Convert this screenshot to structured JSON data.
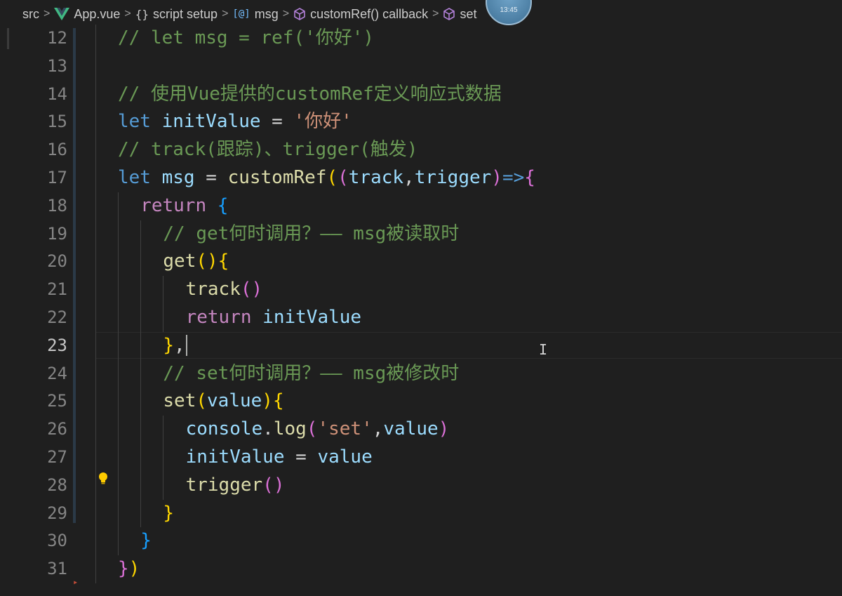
{
  "breadcrumb": {
    "items": [
      {
        "label": "src",
        "icon": ""
      },
      {
        "label": "App.vue",
        "icon": "vue-icon"
      },
      {
        "label": "script setup",
        "icon": "braces-icon"
      },
      {
        "label": "msg",
        "icon": "variable-icon"
      },
      {
        "label": "customRef() callback",
        "icon": "cube-icon"
      },
      {
        "label": "set",
        "icon": "cube-icon"
      }
    ],
    "separator": ">"
  },
  "avatar": {
    "text": "13:45"
  },
  "editor": {
    "current_line": "23",
    "colors": {
      "background": "#1f1f1f",
      "comment": "#6a9955",
      "keyword": "#569cd6",
      "control": "#c586c0",
      "variable": "#9cdcfe",
      "function": "#dcdcaa",
      "string": "#ce9178",
      "bracket_level1": "#ffd700",
      "bracket_level2": "#da70d6",
      "bracket_level3": "#179fff"
    },
    "lines": [
      {
        "n": "12",
        "t": [
          "// let msg = ref('你好')"
        ]
      },
      {
        "n": "13",
        "t": []
      },
      {
        "n": "14",
        "t": [
          "// 使用Vue提供的customRef定义响应式数据"
        ]
      },
      {
        "n": "15",
        "t": [
          "let",
          " ",
          "initValue",
          " = ",
          "'你好'"
        ]
      },
      {
        "n": "16",
        "t": [
          "// track(跟踪)、trigger(触发)"
        ]
      },
      {
        "n": "17",
        "t": [
          "let",
          " ",
          "msg",
          " = ",
          "customRef",
          "(",
          "(",
          "track",
          ",",
          "trigger",
          ")",
          "=>",
          "{"
        ]
      },
      {
        "n": "18",
        "t": [
          "return",
          " ",
          "{"
        ]
      },
      {
        "n": "19",
        "t": [
          "// get何时调用？—— msg被读取时"
        ]
      },
      {
        "n": "20",
        "t": [
          "get",
          "(",
          ")",
          "{"
        ]
      },
      {
        "n": "21",
        "t": [
          "track",
          "(",
          ")"
        ]
      },
      {
        "n": "22",
        "t": [
          "return",
          " ",
          "initValue"
        ]
      },
      {
        "n": "23",
        "t": [
          "}",
          ","
        ]
      },
      {
        "n": "24",
        "t": [
          "// set何时调用？—— msg被修改时"
        ]
      },
      {
        "n": "25",
        "t": [
          "set",
          "(",
          "value",
          ")",
          "{"
        ]
      },
      {
        "n": "26",
        "t": [
          "console",
          ".",
          "log",
          "(",
          "'set'",
          ",",
          "value",
          ")"
        ]
      },
      {
        "n": "27",
        "t": [
          "initValue",
          " = ",
          "value"
        ]
      },
      {
        "n": "28",
        "t": [
          "trigger",
          "(",
          ")"
        ]
      },
      {
        "n": "29",
        "t": [
          "}"
        ]
      },
      {
        "n": "30",
        "t": [
          "}"
        ]
      },
      {
        "n": "31",
        "t": [
          "}",
          ")"
        ]
      }
    ]
  },
  "lightbulb": {
    "icon": "lightbulb-icon"
  },
  "cursor": {
    "icon": "text-cursor-icon"
  }
}
